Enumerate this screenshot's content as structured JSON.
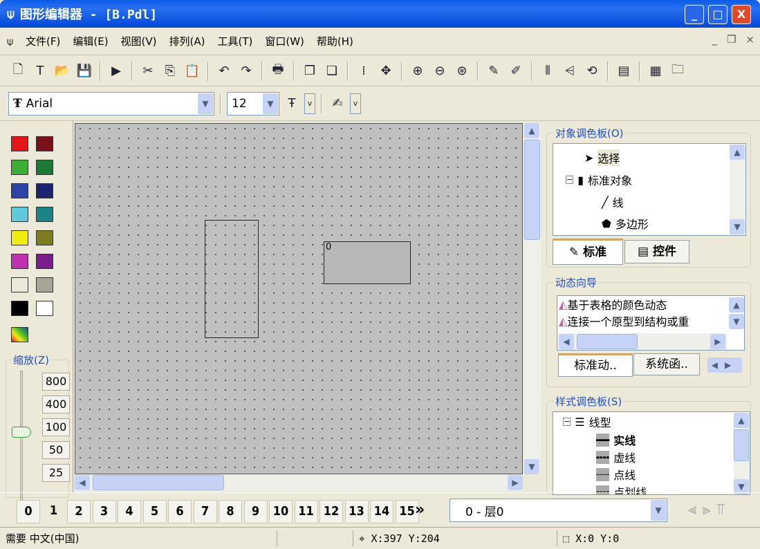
{
  "window": {
    "title": "图形编辑器 - [B.Pdl]",
    "minimize": "_",
    "maximize": "□",
    "close": "X"
  },
  "menu": [
    "文件(F)",
    "编辑(E)",
    "视图(V)",
    "排列(A)",
    "工具(T)",
    "窗口(W)",
    "帮助(H)"
  ],
  "mdi": {
    "minimize": "_",
    "restore": "❐",
    "close": "×"
  },
  "toolbar_icons": [
    {
      "name": "new-icon",
      "g": "🗋"
    },
    {
      "name": "new-template-icon",
      "g": "T"
    },
    {
      "name": "open-icon",
      "g": "📂"
    },
    {
      "name": "save-icon",
      "g": "💾"
    },
    {
      "sep": true
    },
    {
      "name": "run-icon",
      "g": "▶"
    },
    {
      "sep": true
    },
    {
      "name": "cut-icon",
      "g": "✂"
    },
    {
      "name": "copy-icon",
      "g": "⎘"
    },
    {
      "name": "paste-icon",
      "g": "📋"
    },
    {
      "sep": true
    },
    {
      "name": "undo-icon",
      "g": "↶"
    },
    {
      "name": "redo-icon",
      "g": "↷"
    },
    {
      "sep": true
    },
    {
      "name": "print-icon",
      "g": "🖶"
    },
    {
      "sep": true
    },
    {
      "name": "bring-front-icon",
      "g": "❐"
    },
    {
      "name": "send-back-icon",
      "g": "❏"
    },
    {
      "sep": true
    },
    {
      "name": "grid-icon",
      "g": "⁞"
    },
    {
      "name": "snap-grid-icon",
      "g": "✥"
    },
    {
      "sep": true
    },
    {
      "name": "zoom-in-icon",
      "g": "⊕"
    },
    {
      "name": "zoom-out-icon",
      "g": "⊖"
    },
    {
      "name": "zoom-fit-icon",
      "g": "⊛"
    },
    {
      "sep": true
    },
    {
      "name": "pipette-icon",
      "g": "✎"
    },
    {
      "name": "pipette-apply-icon",
      "g": "✐"
    },
    {
      "sep": true
    },
    {
      "name": "mirror-horizontal-icon",
      "g": "⫴"
    },
    {
      "name": "mirror-vertical-icon",
      "g": "⩤"
    },
    {
      "name": "rotate-icon",
      "g": "⟲"
    },
    {
      "sep": true
    },
    {
      "name": "properties-icon",
      "g": "▤"
    },
    {
      "sep": true
    },
    {
      "name": "layers-icon",
      "g": "▦"
    },
    {
      "name": "library-icon",
      "g": "🗀"
    }
  ],
  "font": {
    "name": "Arial",
    "size": "12"
  },
  "palette": [
    "#e8141c",
    "#7a1018",
    "#3cb034",
    "#1a7a36",
    "#2a44a8",
    "#1c2470",
    "#5ecadc",
    "#1a8484",
    "#f0ec10",
    "#7c7c20",
    "#c030b0",
    "#7a1c8c",
    "#ece9d8",
    "#a8a498",
    "#000000",
    "#ffffff"
  ],
  "zoom": {
    "label": "缩放(Z)",
    "levels": [
      "800",
      "400",
      "100",
      "50",
      "25"
    ],
    "value": 100
  },
  "canvas": {
    "text_object": "0"
  },
  "object_palette": {
    "label": "对象调色板(O)",
    "items": [
      "选择",
      "标准对象",
      "线",
      "多边形"
    ],
    "tabs": [
      "标准",
      "控件"
    ]
  },
  "dynamic_wizard": {
    "label": "动态向导",
    "items": [
      "基于表格的颜色动态",
      "连接一个原型到结构或重"
    ],
    "tabs": [
      "标准动..",
      "系统函.."
    ]
  },
  "style_palette": {
    "label": "样式调色板(S)",
    "items": [
      "线型",
      "实线",
      "虚线",
      "点线",
      "点划线"
    ]
  },
  "layers": {
    "buttons": [
      "0",
      "1",
      "2",
      "3",
      "4",
      "5",
      "6",
      "7",
      "8",
      "9",
      "10",
      "11",
      "12",
      "13",
      "14",
      "15"
    ],
    "more": "»",
    "selected": "0 - 层0"
  },
  "status": {
    "lang": "需要 中文(中国)",
    "cursor": "X:397 Y:204",
    "size": "X:0 Y:0"
  }
}
